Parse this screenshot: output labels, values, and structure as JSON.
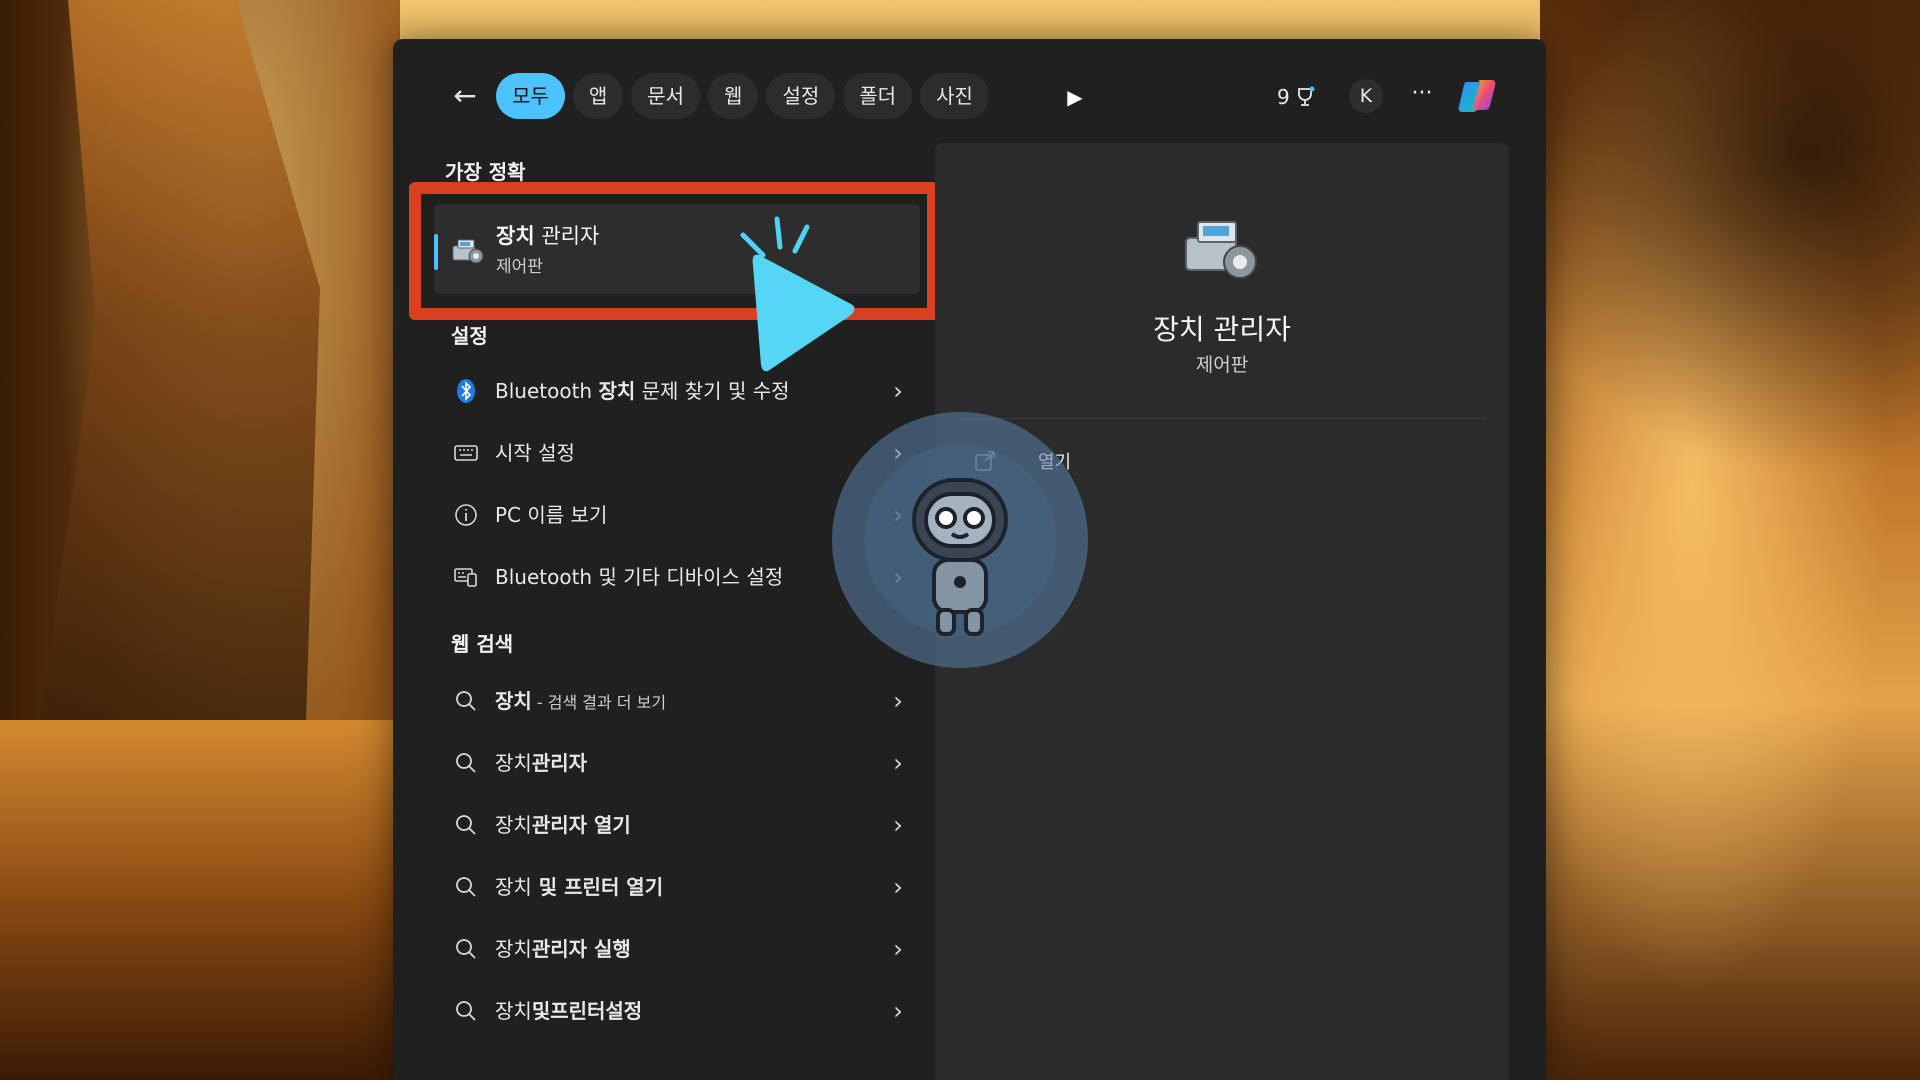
{
  "topbar": {
    "back_label": "←",
    "tabs": [
      {
        "label": "모두",
        "active": true
      },
      {
        "label": "앱"
      },
      {
        "label": "문서"
      },
      {
        "label": "웹"
      },
      {
        "label": "설정"
      },
      {
        "label": "폴더"
      },
      {
        "label": "사진"
      }
    ],
    "play_label": "▶",
    "points": "9",
    "avatar_initial": "K",
    "more_label": "···"
  },
  "sections": {
    "best_match_heading": "가장 정확",
    "settings_heading": "설정",
    "web_search_heading": "웹 검색"
  },
  "best_match": {
    "title_bold": "장치",
    "title_rest": " 관리자",
    "subtitle": "제어판"
  },
  "settings_items": [
    {
      "icon": "bluetooth-icon",
      "prefix": "Bluetooth ",
      "bold": "장치",
      "suffix": " 문제 찾기 및 수정"
    },
    {
      "icon": "keyboard-icon",
      "prefix": "시작 설정",
      "bold": "",
      "suffix": ""
    },
    {
      "icon": "info-icon",
      "prefix": "PC 이름 보기",
      "bold": "",
      "suffix": ""
    },
    {
      "icon": "devices-icon",
      "prefix": "Bluetooth 및 기타 디바이스 설정",
      "bold": "",
      "suffix": ""
    }
  ],
  "web_items": [
    {
      "bold": "장치",
      "rest": "",
      "small": " - 검색 결과 더 보기"
    },
    {
      "bold": "",
      "plain": "장치",
      "rest": "관리자",
      "small": ""
    },
    {
      "bold": "",
      "plain": "장치",
      "rest": "관리자 열기",
      "small": ""
    },
    {
      "bold": "",
      "plain": "장치",
      "rest": " 및 프린터 열기",
      "small": ""
    },
    {
      "bold": "",
      "plain": "장치",
      "rest": "관리자 실행",
      "small": ""
    },
    {
      "bold": "",
      "plain": "장치",
      "rest": "및프린터설정",
      "small": ""
    }
  ],
  "preview": {
    "title": "장치 관리자",
    "subtitle": "제어판",
    "open_label": "열기"
  },
  "colors": {
    "accent": "#4cc2ff",
    "highlight_box": "#d9401f",
    "panel_bg": "#202020",
    "preview_bg": "#2b2b2b"
  }
}
